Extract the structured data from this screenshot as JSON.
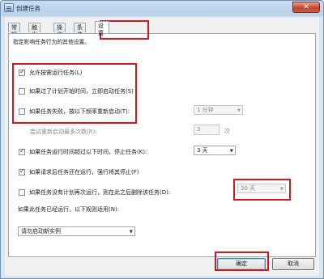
{
  "window": {
    "title": "创建任务",
    "close_glyph": "✕"
  },
  "tabs": [
    {
      "label": "常规"
    },
    {
      "label": "触发器"
    },
    {
      "label": "操作"
    },
    {
      "label": "条件"
    },
    {
      "label": "设置",
      "active": true
    }
  ],
  "settings": {
    "description": "指定影响任务行为的其他设置。",
    "allow_on_demand": {
      "label": "允许按需运行任务(L)",
      "checked": true
    },
    "run_after_missed": {
      "label": "如果过了计划开始时间，立即启动任务(S)",
      "checked": false
    },
    "restart_on_fail": {
      "label": "如果任务失败，按以下频率重新启动(T):",
      "checked": false,
      "value": "1 分钟"
    },
    "restart_attempts": {
      "label": "尝试重新启动最多次数(R):",
      "value": "3",
      "unit": "次"
    },
    "stop_if_longer": {
      "label": "如果任务运行时间超过以下时间，停止任务(K):",
      "checked": true,
      "value": "3 天"
    },
    "force_stop": {
      "label": "如果请求后任务还在运行，强行将其停止(F)",
      "checked": true
    },
    "delete_if_not_scheduled": {
      "label": "如果任务没有计划再次运行，则在此之后删除该任务(D):",
      "checked": false,
      "value": "30 天"
    },
    "if_running_rule": {
      "label": "如果此任务已经运行，以下规则适用(N):",
      "value": "请勿启动新实例"
    }
  },
  "buttons": {
    "ok": "确定",
    "cancel": "取消"
  },
  "colors": {
    "highlight": "#d8161d",
    "title_bg": "#b9d0e8",
    "panel_bg": "#ffffff",
    "dialog_bg": "#f0f0f0"
  },
  "icons": {
    "app": "task-scheduler-icon",
    "dropdown": "chevron-down-icon",
    "check": "checkmark-icon"
  }
}
